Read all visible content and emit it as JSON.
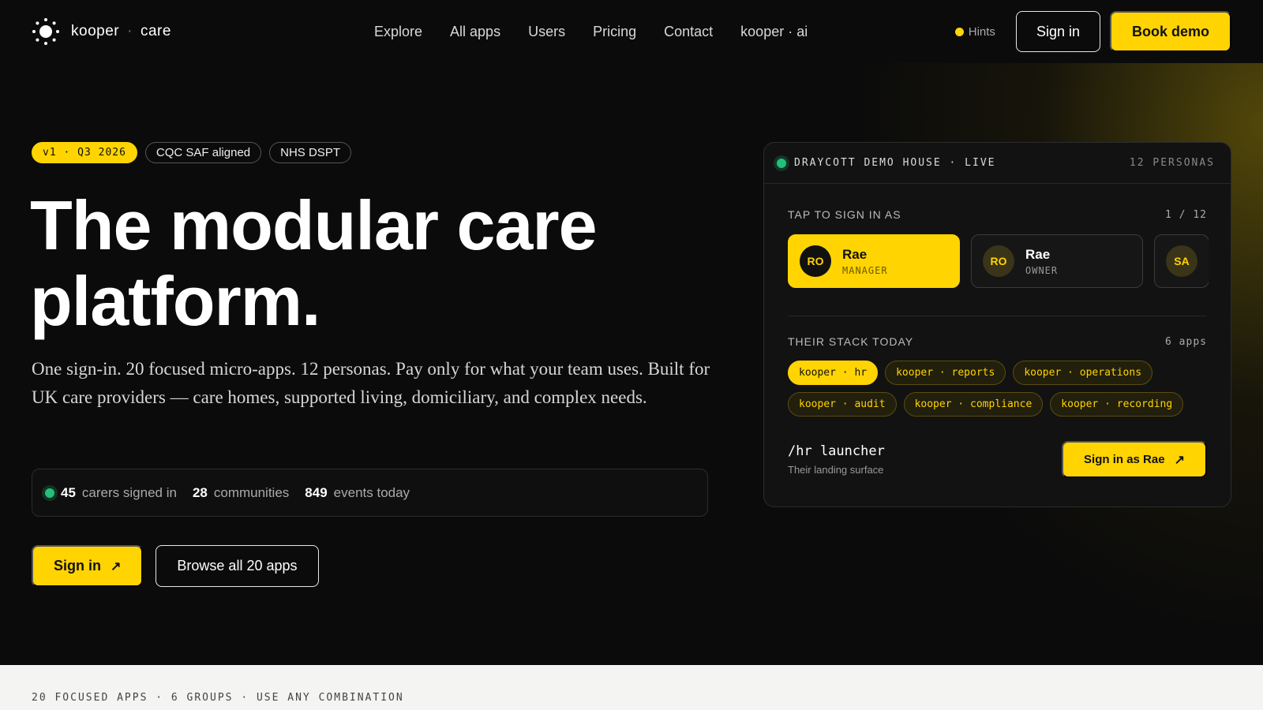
{
  "nav": {
    "brand_name": "kooper",
    "brand_sep": "·",
    "brand_product": "care",
    "links": [
      "Explore",
      "All apps",
      "Users",
      "Pricing",
      "Contact",
      "kooper · ai"
    ],
    "hints_label": "Hints",
    "signin_label": "Sign in",
    "demo_label": "Book demo"
  },
  "hero": {
    "badges": [
      "v1 · Q3 2026",
      "CQC SAF aligned",
      "NHS DSPT"
    ],
    "headline_line1": "The modular care",
    "headline_line2": "platform.",
    "subcopy": "One sign-in. 20 focused micro-apps. 12 personas. Pay only for what your team uses. Built for UK care providers — care homes, supported living, domiciliary, and complex needs.",
    "stats": [
      {
        "value": "45",
        "label": "carers signed in"
      },
      {
        "value": "28",
        "label": "communities"
      },
      {
        "value": "849",
        "label": "events today"
      }
    ],
    "cta_signin": "Sign in",
    "cta_browse": "Browse all 20 apps"
  },
  "panel": {
    "title": "DRAYCOTT DEMO HOUSE · LIVE",
    "personas_count": "12 PERSONAS",
    "tap_label": "TAP TO SIGN IN AS",
    "page": "1 / 12",
    "personas": [
      {
        "initials": "RO",
        "name": "Rae",
        "role": "MANAGER"
      },
      {
        "initials": "RO",
        "name": "Rae",
        "role": "OWNER"
      },
      {
        "initials": "SA"
      }
    ],
    "stack_label": "THEIR STACK TODAY",
    "stack_count": "6 apps",
    "apps": [
      "kooper · hr",
      "kooper · reports",
      "kooper · operations",
      "kooper · audit",
      "kooper · compliance",
      "kooper · recording"
    ],
    "launcher_title": "/hr launcher",
    "launcher_sub": "Their landing surface",
    "launcher_button": "Sign in as Rae"
  },
  "bottom": {
    "strip_text": "20 FOCUSED APPS · 6 GROUPS · USE ANY COMBINATION"
  },
  "colors": {
    "accent": "#ffd400",
    "live": "#22c07a",
    "background": "#0b0b0b"
  },
  "icons": [
    "sun-logo-icon",
    "arrow-up-right-icon"
  ]
}
